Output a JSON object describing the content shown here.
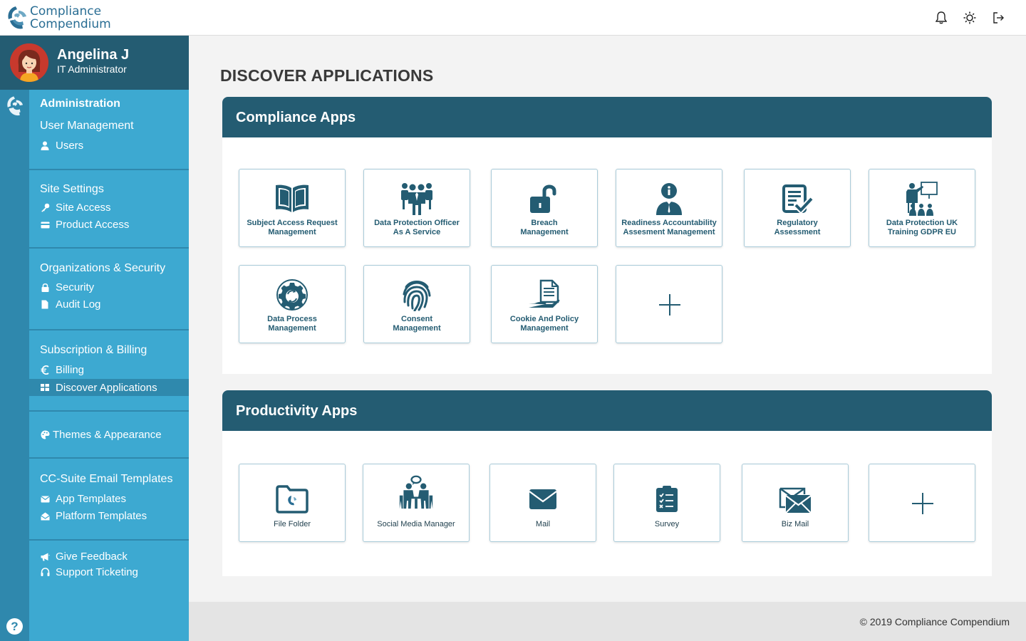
{
  "brand": {
    "line1": "Compliance",
    "line2": "Compendium"
  },
  "topbar": {
    "icons": [
      "bell-icon",
      "sun-icon",
      "logout-icon"
    ]
  },
  "user": {
    "name": "Angelina J",
    "role": "IT Administrator"
  },
  "sidebar": {
    "administration": "Administration",
    "user_management": {
      "title": "User Management",
      "items": [
        {
          "label": "Users",
          "icon": "user-icon"
        }
      ]
    },
    "site_settings": {
      "title": "Site Settings",
      "items": [
        {
          "label": "Site Access",
          "icon": "key-icon"
        },
        {
          "label": "Product Access",
          "icon": "card-icon"
        }
      ]
    },
    "org_security": {
      "title": "Organizations & Security",
      "items": [
        {
          "label": "Security",
          "icon": "lock-icon"
        },
        {
          "label": "Audit Log",
          "icon": "file-icon"
        }
      ]
    },
    "subscription": {
      "title": "Subscription & Billing",
      "items": [
        {
          "label": "Billing",
          "icon": "euro-icon"
        },
        {
          "label": "Discover Applications",
          "icon": "grid-icon"
        }
      ]
    },
    "themes": {
      "label": "Themes & Appearance",
      "icon": "palette-icon"
    },
    "email_templates": {
      "title": "CC-Suite Email Templates",
      "items": [
        {
          "label": "App Templates",
          "icon": "envelope-icon"
        },
        {
          "label": "Platform Templates",
          "icon": "envelope-open-icon"
        }
      ]
    },
    "support": {
      "items": [
        {
          "label": "Give Feedback",
          "icon": "megaphone-icon"
        },
        {
          "label": "Support Ticketing",
          "icon": "headset-icon"
        }
      ]
    },
    "help": "?"
  },
  "main": {
    "title": "DISCOVER APPLICATIONS",
    "compliance": {
      "title": "Compliance Apps",
      "apps": [
        {
          "line1": "Subject Access Request",
          "line2": "Management",
          "icon": "open-book-icon"
        },
        {
          "line1": "Data Protection Officer",
          "line2": "As A Service",
          "icon": "team-icon"
        },
        {
          "line1": "Breach",
          "line2": "Management",
          "icon": "unlock-icon"
        },
        {
          "line1": "Readiness Accountability",
          "line2": "Assesment Management",
          "icon": "info-person-icon"
        },
        {
          "line1": "Regulatory",
          "line2": "Assessment",
          "icon": "checklist-icon"
        },
        {
          "line1": "Data Protection UK",
          "line2": "Training GDPR EU",
          "icon": "training-icon"
        },
        {
          "line1": "Data Process",
          "line2": "Management",
          "icon": "process-gear-icon"
        },
        {
          "line1": "Consent",
          "line2": "Management",
          "icon": "fingerprint-icon"
        },
        {
          "line1": "Cookie And Policy",
          "line2": "Management",
          "icon": "hand-document-icon"
        }
      ],
      "add_symbol": "+"
    },
    "productivity": {
      "title": "Productivity Apps",
      "apps": [
        {
          "label": "File Folder",
          "icon": "folder-icon"
        },
        {
          "label": "Social Media Manager",
          "icon": "meeting-icon"
        },
        {
          "label": "Mail",
          "icon": "mail-icon"
        },
        {
          "label": "Survey",
          "icon": "survey-icon"
        },
        {
          "label": "Biz Mail",
          "icon": "biz-mail-icon"
        }
      ],
      "add_symbol": "+"
    }
  },
  "footer": "© 2019 Compliance Compendium",
  "colors": {
    "primary_dark": "#245c72",
    "sidebar": "#3da9d1",
    "rail": "#2f88ad",
    "accent": "#2a6e94"
  }
}
